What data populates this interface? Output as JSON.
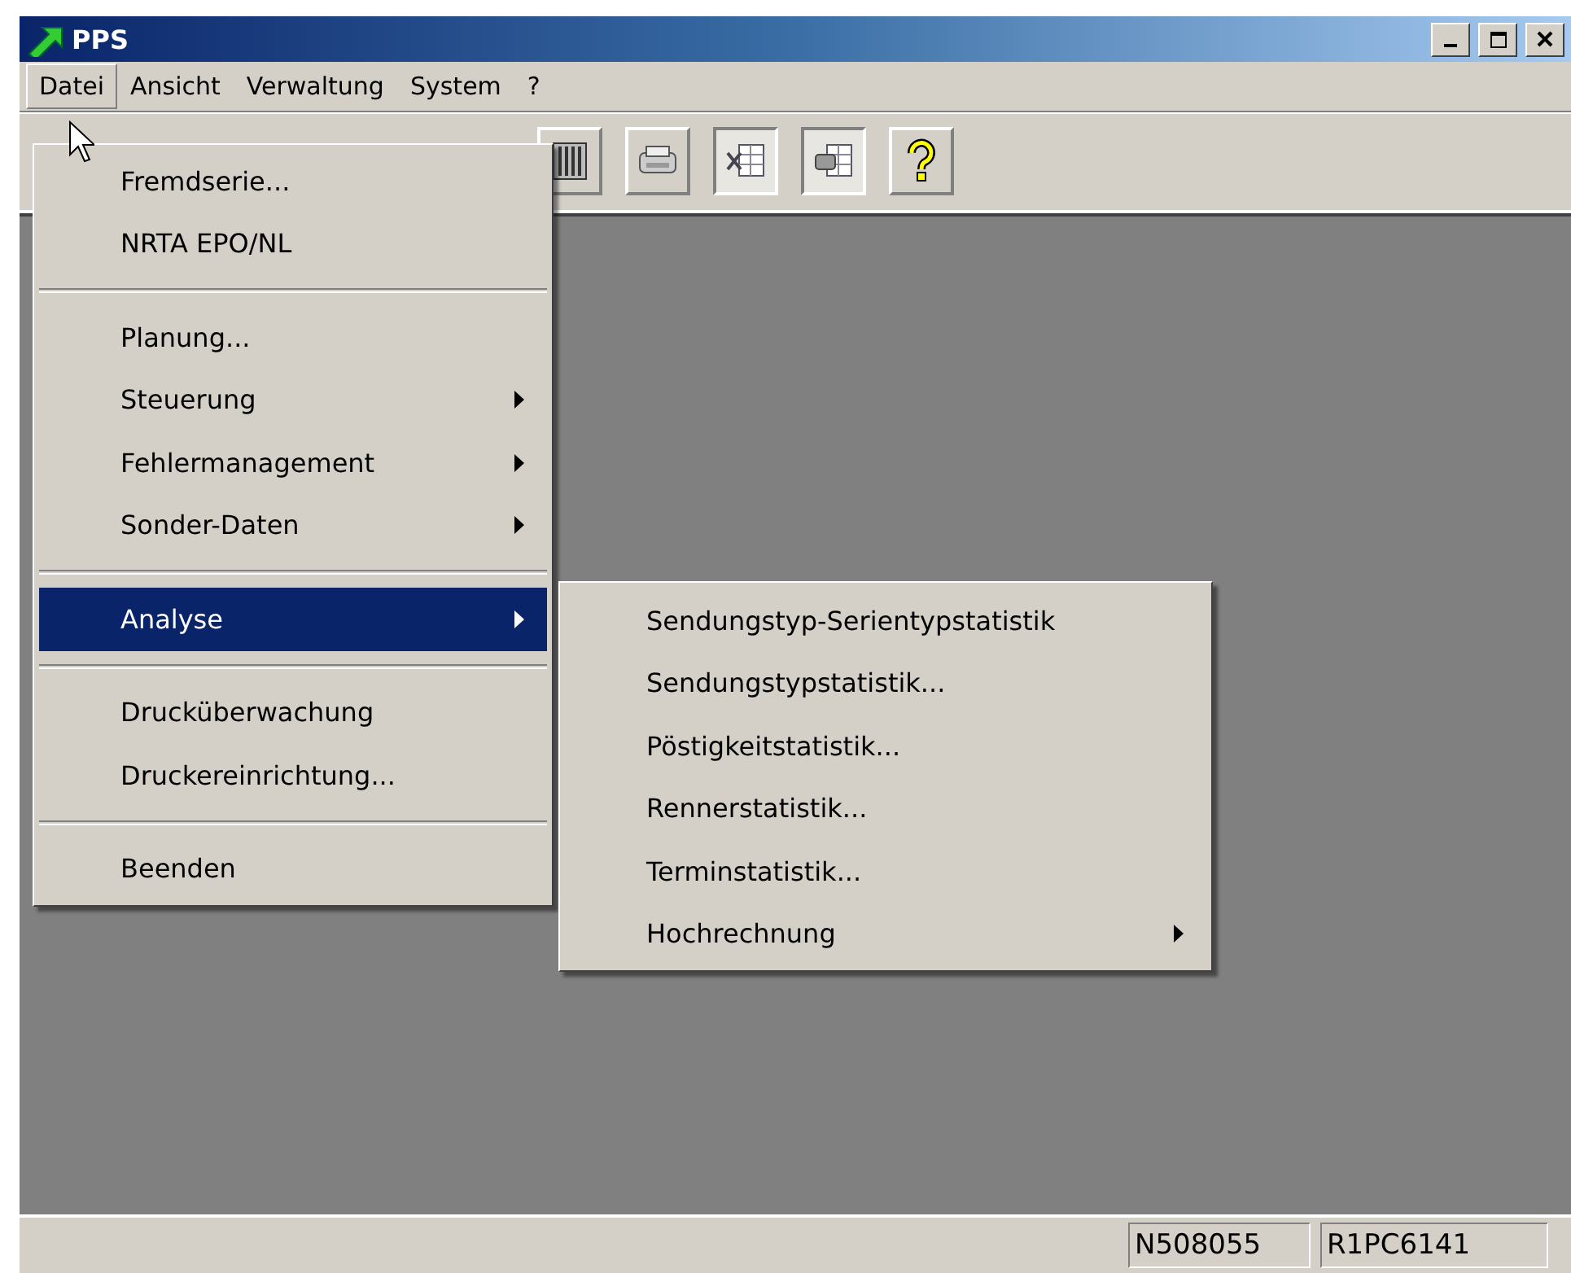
{
  "window": {
    "title": "PPS"
  },
  "menubar": [
    {
      "label": "Datei",
      "selected": true
    },
    {
      "label": "Ansicht",
      "selected": false
    },
    {
      "label": "Verwaltung",
      "selected": false
    },
    {
      "label": "System",
      "selected": false
    },
    {
      "label": "?",
      "selected": false
    }
  ],
  "toolbar": [
    {
      "kind": "grid",
      "pressed": false
    },
    {
      "kind": "printer",
      "pressed": false
    },
    {
      "kind": "sheet",
      "pressed": true
    },
    {
      "kind": "sheet-print",
      "pressed": true
    },
    {
      "kind": "help",
      "pressed": false
    }
  ],
  "menu": [
    {
      "kind": "item",
      "label": "Fremdserie...",
      "submenu": false,
      "selected": false
    },
    {
      "kind": "item",
      "label": "NRTA EPO/NL",
      "submenu": false,
      "selected": false
    },
    {
      "kind": "separator"
    },
    {
      "kind": "item",
      "label": "Planung...",
      "submenu": false,
      "selected": false
    },
    {
      "kind": "item",
      "label": "Steuerung",
      "submenu": true,
      "selected": false
    },
    {
      "kind": "item",
      "label": "Fehlermanagement",
      "submenu": true,
      "selected": false
    },
    {
      "kind": "item",
      "label": "Sonder-Daten",
      "submenu": true,
      "selected": false
    },
    {
      "kind": "separator"
    },
    {
      "kind": "item",
      "label": "Analyse",
      "submenu": true,
      "selected": true
    },
    {
      "kind": "separator"
    },
    {
      "kind": "item",
      "label": "Drucküberwachung",
      "submenu": false,
      "selected": false
    },
    {
      "kind": "item",
      "label": "Druckereinrichtung...",
      "submenu": false,
      "selected": false
    },
    {
      "kind": "separator"
    },
    {
      "kind": "item",
      "label": "Beenden",
      "submenu": false,
      "selected": false
    }
  ],
  "submenu": [
    {
      "kind": "item",
      "label": "Sendungstyp-Serientypstatistik",
      "submenu": false,
      "selected": false
    },
    {
      "kind": "item",
      "label": "Sendungstypstatistik...",
      "submenu": false,
      "selected": false
    },
    {
      "kind": "item",
      "label": "Pöstigkeitstatistik...",
      "submenu": false,
      "selected": false
    },
    {
      "kind": "item",
      "label": "Rennerstatistik...",
      "submenu": false,
      "selected": false
    },
    {
      "kind": "item",
      "label": "Terminstatistik...",
      "submenu": false,
      "selected": false
    },
    {
      "kind": "item",
      "label": "Hochrechnung",
      "submenu": true,
      "selected": false
    }
  ],
  "status_bar": [
    "N508055",
    "R1PC6141"
  ]
}
